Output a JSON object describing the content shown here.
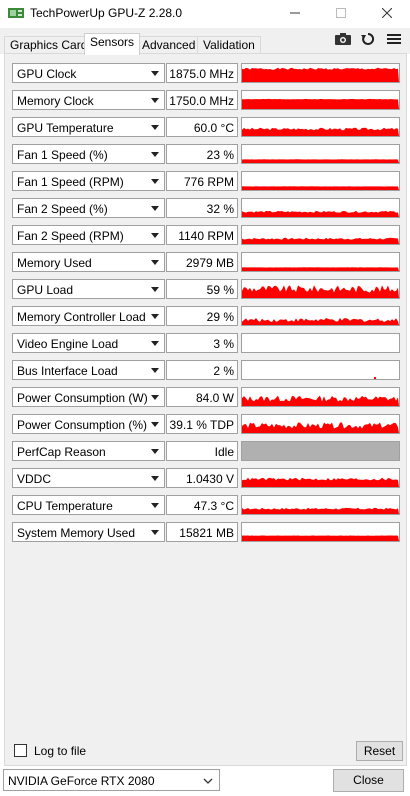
{
  "window": {
    "title": "TechPowerUp GPU-Z 2.28.0",
    "minimize_icon": "minimize-icon",
    "maximize_icon": "maximize-icon",
    "close_icon": "close-icon"
  },
  "tabs": [
    {
      "label": "Graphics Card",
      "active": false
    },
    {
      "label": "Sensors",
      "active": true
    },
    {
      "label": "Advanced",
      "active": false
    },
    {
      "label": "Validation",
      "active": false
    }
  ],
  "toolbar": {
    "camera_icon": "camera-icon",
    "refresh_icon": "refresh-icon",
    "menu_icon": "hamburger-menu-icon"
  },
  "sensors": [
    {
      "name": "GPU Clock",
      "value": "1875.0 MHz",
      "graph_level": 0.75,
      "graph_style": "high"
    },
    {
      "name": "Memory Clock",
      "value": "1750.0 MHz",
      "graph_level": 0.55,
      "graph_style": "solid"
    },
    {
      "name": "GPU Temperature",
      "value": "60.0 °C",
      "graph_level": 0.4,
      "graph_style": "medium"
    },
    {
      "name": "Fan 1 Speed (%)",
      "value": "23 %",
      "graph_level": 0.2,
      "graph_style": "low"
    },
    {
      "name": "Fan 1 Speed (RPM)",
      "value": "776 RPM",
      "graph_level": 0.2,
      "graph_style": "low"
    },
    {
      "name": "Fan 2 Speed (%)",
      "value": "32 %",
      "graph_level": 0.3,
      "graph_style": "lowvar"
    },
    {
      "name": "Fan 2 Speed (RPM)",
      "value": "1140 RPM",
      "graph_level": 0.3,
      "graph_style": "lowvar"
    },
    {
      "name": "Memory Used",
      "value": "2979 MB",
      "graph_level": 0.2,
      "graph_style": "flat"
    },
    {
      "name": "GPU Load",
      "value": "59 %",
      "graph_level": 0.55,
      "graph_style": "spiky"
    },
    {
      "name": "Memory Controller Load",
      "value": "29 %",
      "graph_level": 0.3,
      "graph_style": "spiky"
    },
    {
      "name": "Video Engine Load",
      "value": "3 %",
      "graph_level": 0.0,
      "graph_style": "empty"
    },
    {
      "name": "Bus Interface Load",
      "value": "2 %",
      "graph_level": 0.05,
      "graph_style": "dot"
    },
    {
      "name": "Power Consumption (W)",
      "value": "84.0 W",
      "graph_level": 0.45,
      "graph_style": "spiky"
    },
    {
      "name": "Power Consumption (%)",
      "value": "39.1 % TDP",
      "graph_level": 0.45,
      "graph_style": "spiky"
    },
    {
      "name": "PerfCap Reason",
      "value": "Idle",
      "graph_level": 1.0,
      "graph_style": "gray"
    },
    {
      "name": "VDDC",
      "value": "1.0430 V",
      "graph_level": 0.45,
      "graph_style": "medium"
    },
    {
      "name": "CPU Temperature",
      "value": "47.3 °C",
      "graph_level": 0.3,
      "graph_style": "lowvar"
    },
    {
      "name": "System Memory Used",
      "value": "15821 MB",
      "graph_level": 0.3,
      "graph_style": "flat"
    }
  ],
  "log_to_file": {
    "label": "Log to file",
    "checked": false
  },
  "reset_label": "Reset",
  "gpu_select": {
    "value": "NVIDIA GeForce RTX 2080"
  },
  "close_label": "Close",
  "colors": {
    "graph_red": "#ff0000",
    "graph_gray": "#b0b0b0"
  }
}
